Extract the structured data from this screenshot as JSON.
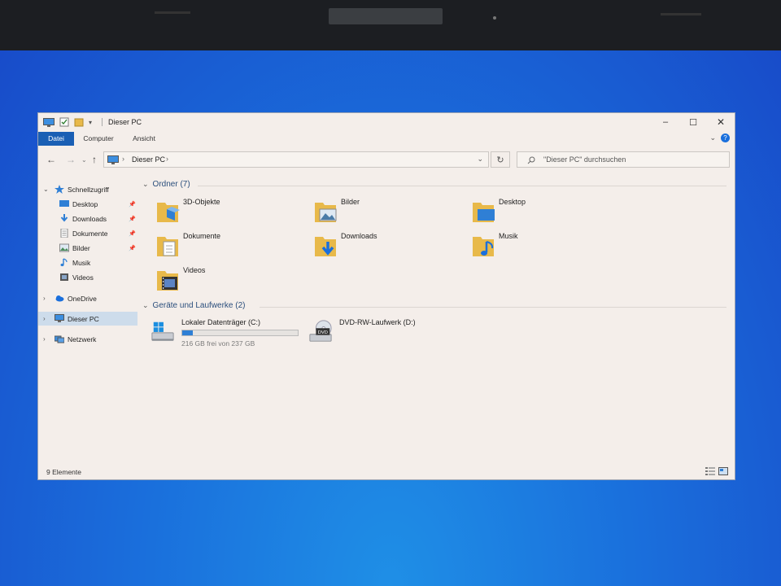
{
  "window": {
    "title": "Dieser PC"
  },
  "ribbon": {
    "tabs": [
      {
        "label": "Datei",
        "active": true
      },
      {
        "label": "Computer",
        "active": false
      },
      {
        "label": "Ansicht",
        "active": false
      }
    ]
  },
  "address": {
    "path": "Dieser PC",
    "search_placeholder": "\"Dieser PC\" durchsuchen"
  },
  "sidebar": {
    "items": [
      {
        "label": "Schnellzugriff",
        "icon": "star-icon"
      },
      {
        "label": "Desktop",
        "icon": "desktop-icon",
        "pinned": true
      },
      {
        "label": "Downloads",
        "icon": "download-icon",
        "pinned": true
      },
      {
        "label": "Dokumente",
        "icon": "document-icon",
        "pinned": true
      },
      {
        "label": "Bilder",
        "icon": "pictures-icon",
        "pinned": true
      },
      {
        "label": "Musik",
        "icon": "music-icon"
      },
      {
        "label": "Videos",
        "icon": "video-icon"
      },
      {
        "label": "OneDrive",
        "icon": "cloud-icon"
      },
      {
        "label": "Dieser PC",
        "icon": "computer-icon",
        "selected": true
      },
      {
        "label": "Netzwerk",
        "icon": "network-icon"
      }
    ]
  },
  "folders": {
    "header": "Ordner (7)",
    "items": [
      "3D-Objekte",
      "Bilder",
      "Desktop",
      "Dokumente",
      "Downloads",
      "Musik",
      "Videos"
    ]
  },
  "drives": {
    "header": "Geräte und Laufwerke (2)",
    "items": [
      {
        "label": "Lokaler Datenträger (C:)",
        "free": "216 GB frei von 237 GB",
        "used_fraction": 0.09
      },
      {
        "label": "DVD-RW-Laufwerk (D:)"
      }
    ]
  },
  "status": {
    "text": "9 Elemente"
  },
  "colors": {
    "accent": "#1a5fb4",
    "folder": "#e8b94a",
    "drive_bar": "#2f7fd5"
  }
}
